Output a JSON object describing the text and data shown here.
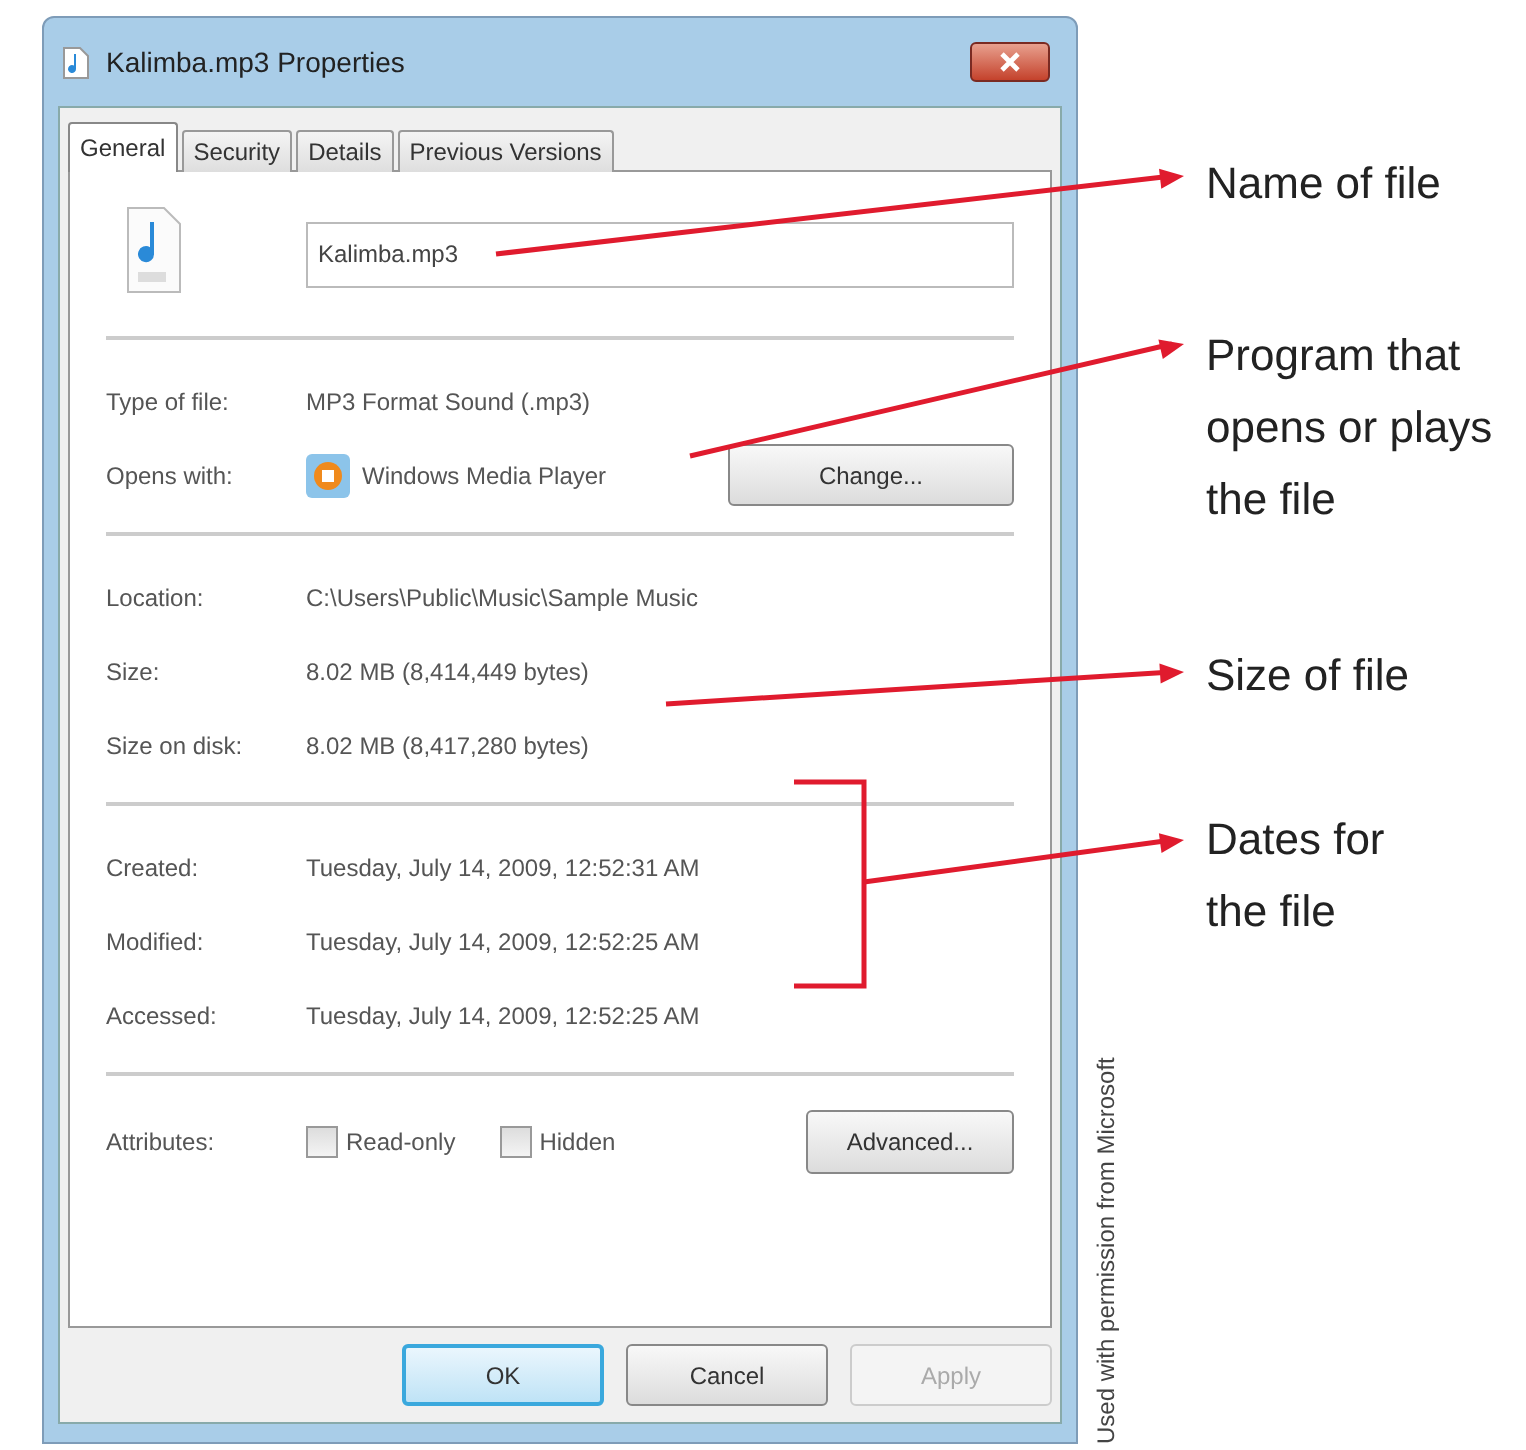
{
  "window": {
    "title": "Kalimba.mp3 Properties"
  },
  "tabs": [
    {
      "label": "General",
      "selected": true
    },
    {
      "label": "Security",
      "selected": false
    },
    {
      "label": "Details",
      "selected": false
    },
    {
      "label": "Previous Versions",
      "selected": false
    }
  ],
  "file_name": {
    "value": "Kalimba.mp3"
  },
  "sections": [
    {
      "rows": [
        {
          "kind": "text",
          "label": "Type of file:",
          "value": "MP3 Format Sound (.mp3)"
        },
        {
          "kind": "program",
          "label": "Opens with:",
          "value": "Windows Media Player",
          "button": "Change..."
        }
      ]
    },
    {
      "rows": [
        {
          "kind": "text",
          "label": "Location:",
          "value": "C:\\Users\\Public\\Music\\Sample Music"
        },
        {
          "kind": "text",
          "label": "Size:",
          "value": "8.02 MB (8,414,449 bytes)"
        },
        {
          "kind": "text",
          "label": "Size on disk:",
          "value": "8.02 MB (8,417,280 bytes)"
        }
      ]
    },
    {
      "rows": [
        {
          "kind": "text",
          "label": "Created:",
          "value": "Tuesday, July 14, 2009, 12:52:31 AM"
        },
        {
          "kind": "text",
          "label": "Modified:",
          "value": "Tuesday, July 14, 2009, 12:52:25 AM"
        },
        {
          "kind": "text",
          "label": "Accessed:",
          "value": "Tuesday, July 14, 2009, 12:52:25 AM"
        }
      ]
    }
  ],
  "attributes": {
    "label": "Attributes:",
    "checkboxes": [
      {
        "label": "Read-only",
        "checked": false
      },
      {
        "label": "Hidden",
        "checked": false
      }
    ],
    "button": "Advanced..."
  },
  "buttons": [
    {
      "label": "OK",
      "default": true,
      "disabled": false
    },
    {
      "label": "Cancel",
      "default": false,
      "disabled": false
    },
    {
      "label": "Apply",
      "default": false,
      "disabled": true
    }
  ],
  "annotations": [
    {
      "lines": [
        "Name of file"
      ]
    },
    {
      "lines": [
        "Program that",
        "opens or plays",
        "the file"
      ]
    },
    {
      "lines": [
        "Size of file"
      ]
    },
    {
      "lines": [
        "Dates for",
        "the file"
      ]
    }
  ],
  "credit": "Used with permission from Microsoft"
}
